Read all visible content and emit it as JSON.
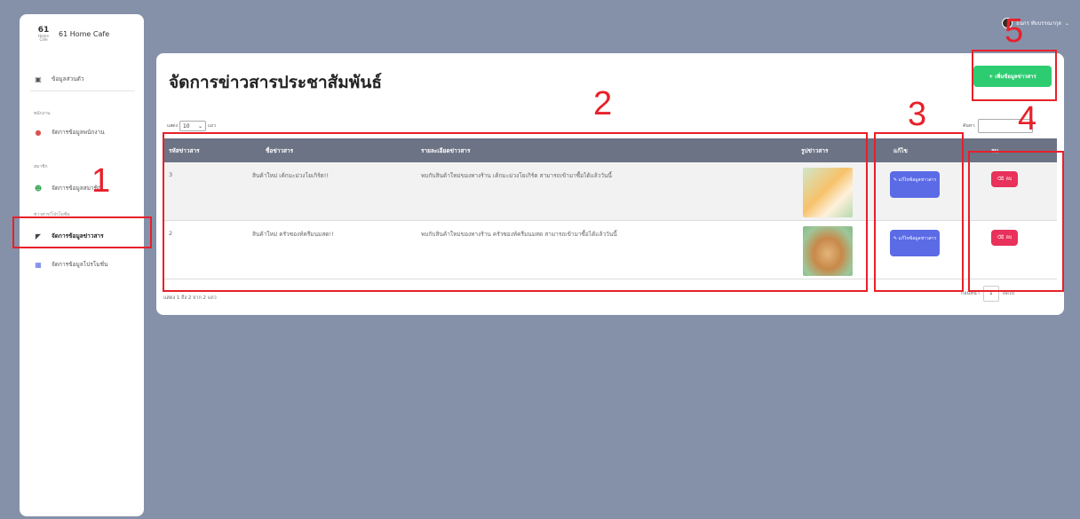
{
  "brand": {
    "logo_text": "61",
    "logo_sub": "Home Cafe",
    "name": "61 Home Cafe"
  },
  "sidebar": {
    "items": [
      {
        "label": "ข้อมูลส่วนตัว",
        "icon": "id-card-icon"
      },
      {
        "label": "จัดการข้อมูลพนักงาน",
        "icon": "user-icon"
      },
      {
        "label": "จัดการข้อมูลสมาชิก",
        "icon": "users-icon"
      },
      {
        "label": "จัดการข้อมูลข่าวสาร",
        "icon": "megaphone-icon"
      },
      {
        "label": "จัดการข้อมูลโปรโมชั่น",
        "icon": "gift-icon"
      }
    ],
    "sections": [
      "พนักงาน",
      "สมาชิก",
      "ข่าวสาร/โปรโมชั่น"
    ]
  },
  "user": {
    "name": "ธนกร ทับบรรณากุล"
  },
  "page": {
    "title": "จัดการข่าวสารประชาสัมพันธ์",
    "add_button": "เพิ่มข้อมูลข่าวสาร"
  },
  "controls": {
    "show_label": "แสดง",
    "show_value": "10",
    "rows_label": "แถว",
    "search_label": "ค้นหา:"
  },
  "table": {
    "headers": [
      "รหัสข่าวสาร",
      "ชื่อข่าวสาร",
      "รายละเอียดข่าวสาร",
      "รูปข่าวสาร",
      "แก้ไข",
      "ลบ"
    ],
    "rows": [
      {
        "id": "3",
        "name": "สินค้าใหม่ เค้กมะม่วงโยเกิร์ต!!",
        "detail": "พบกับสินค้าใหม่ของทางร้าน เค้กมะม่วงโยเกิร์ต สามารถเข้ามาซื้อได้แล้ววันนี้",
        "edit_label": "แก้ไขข้อมูลข่าวสาร",
        "delete_label": "ลบ"
      },
      {
        "id": "2",
        "name": "สินค้าใหม่ ครัวซองท์ครีมนมสด!!",
        "detail": "พบกับสินค้าใหม่ของทางร้าน ครัวซองท์ครีมนมสด สามารถเข้ามาซื้อได้แล้ววันนี้",
        "edit_label": "แก้ไขข้อมูลข่าวสาร",
        "delete_label": "ลบ"
      }
    ]
  },
  "footer": {
    "info": "แสดง 1 ถึง 2 จาก 2 แถว",
    "prev": "ก่อนหน้า",
    "page": "1",
    "next": "ถัดไป"
  },
  "annotations": [
    "1",
    "2",
    "3",
    "4",
    "5"
  ],
  "colors": {
    "background": "#8591a9",
    "accent_green": "#2ecc71",
    "edit_blue": "#5b6be6",
    "delete_red": "#e8315b",
    "annotation_red": "#e8202a",
    "table_header": "#6c7385"
  }
}
